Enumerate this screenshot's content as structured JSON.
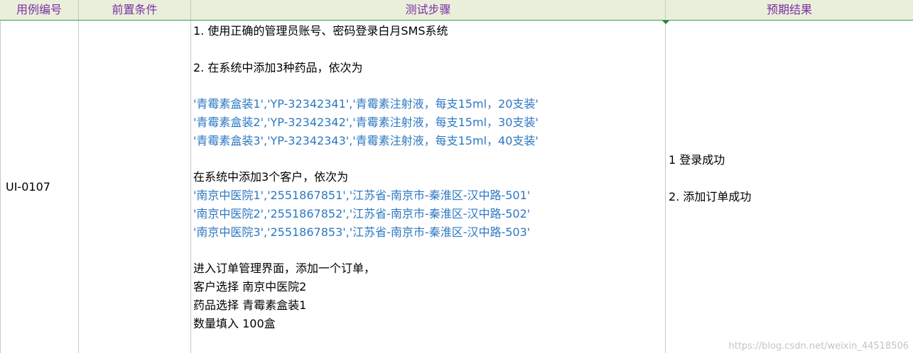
{
  "table": {
    "headers": [
      "用例编号",
      "前置条件",
      "测试步骤",
      "预期结果"
    ],
    "row": {
      "case_id": "UI-0107",
      "precondition": "",
      "steps": [
        {
          "text": "1. 使用正确的管理员账号、密码登录白月SMS系统",
          "color": "black"
        },
        {
          "text": "",
          "color": "black"
        },
        {
          "text": "2. 在系统中添加3种药品，依次为",
          "color": "black"
        },
        {
          "text": "",
          "color": "black"
        },
        {
          "text": "'青霉素盒装1','YP-32342341','青霉素注射液，每支15ml，20支装'",
          "color": "blue"
        },
        {
          "text": "'青霉素盒装2','YP-32342342','青霉素注射液，每支15ml，30支装'",
          "color": "blue"
        },
        {
          "text": "'青霉素盒装3','YP-32342343','青霉素注射液，每支15ml，40支装'",
          "color": "blue"
        },
        {
          "text": "",
          "color": "black"
        },
        {
          "text": "在系统中添加3个客户，依次为",
          "color": "black"
        },
        {
          "text": "'南京中医院1','2551867851','江苏省-南京市-秦淮区-汉中路-501'",
          "color": "blue"
        },
        {
          "text": "'南京中医院2','2551867852','江苏省-南京市-秦淮区-汉中路-502'",
          "color": "blue"
        },
        {
          "text": "'南京中医院3','2551867853','江苏省-南京市-秦淮区-汉中路-503'",
          "color": "blue"
        },
        {
          "text": "",
          "color": "black"
        },
        {
          "text": "进入订单管理界面，添加一个订单，",
          "color": "black"
        },
        {
          "text": "客户选择 南京中医院2",
          "color": "black"
        },
        {
          "text": "药品选择 青霉素盒装1",
          "color": "black"
        },
        {
          "text": "数量填入 100盒",
          "color": "black"
        }
      ],
      "expected": [
        "1 登录成功",
        "",
        "2. 添加订单成功"
      ]
    }
  },
  "watermark": "https://blog.csdn.net/weixin_44518506",
  "colors": {
    "header_bg": "#eaefdc",
    "header_text": "#7a2ea1",
    "header_border": "#3aa04b",
    "blue_text": "#2d78c1",
    "grid": "#c8c8c8"
  }
}
